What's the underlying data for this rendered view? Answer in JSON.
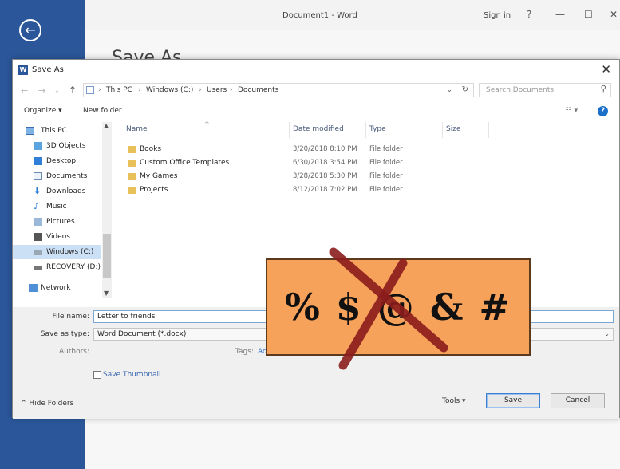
{
  "word": {
    "window_title": "Document1 - Word",
    "sign_in": "Sign in",
    "help": "?",
    "minimize": "—",
    "maximize": "☐",
    "close": "✕",
    "back_arrow": "←",
    "heading": "Save As"
  },
  "dialog": {
    "title": "Save As",
    "close": "✕",
    "back": "←",
    "forward": "→",
    "up": "↑",
    "breadcrumb": [
      "This PC",
      "Windows (C:)",
      "Users",
      "Documents"
    ],
    "search_placeholder": "Search Documents",
    "toolbar": {
      "organize": "Organize ▾",
      "new_folder": "New folder"
    },
    "nav_items": [
      {
        "label": "This PC",
        "icon": "computer-icon"
      },
      {
        "label": "3D Objects",
        "icon": "cube-icon"
      },
      {
        "label": "Desktop",
        "icon": "desktop-icon"
      },
      {
        "label": "Documents",
        "icon": "documents-icon"
      },
      {
        "label": "Downloads",
        "icon": "download-icon"
      },
      {
        "label": "Music",
        "icon": "music-icon"
      },
      {
        "label": "Pictures",
        "icon": "pictures-icon"
      },
      {
        "label": "Videos",
        "icon": "videos-icon"
      },
      {
        "label": "Windows (C:)",
        "icon": "drive-icon",
        "selected": true
      },
      {
        "label": "RECOVERY (D:)",
        "icon": "drive-icon"
      },
      {
        "label": "Network",
        "icon": "network-icon"
      }
    ],
    "columns": [
      "Name",
      "Date modified",
      "Type",
      "Size"
    ],
    "files": [
      {
        "name": "Books",
        "date": "3/20/2018 8:10 PM",
        "type": "File folder"
      },
      {
        "name": "Custom Office Templates",
        "date": "6/30/2018 3:54 PM",
        "type": "File folder"
      },
      {
        "name": "My Games",
        "date": "3/28/2018 5:30 PM",
        "type": "File folder"
      },
      {
        "name": "Projects",
        "date": "8/12/2018 7:02 PM",
        "type": "File folder"
      }
    ],
    "file_name_label": "File name:",
    "file_name_value": "Letter to friends",
    "save_type_label": "Save as type:",
    "save_type_value": "Word Document (*.docx)",
    "authors_label": "Authors:",
    "tags_label": "Tags:",
    "tags_value": "Ad",
    "save_thumbnail": "Save Thumbnail",
    "hide_folders": "Hide Folders",
    "tools": "Tools ▾",
    "save": "Save",
    "cancel": "Cancel"
  },
  "overlay": {
    "symbols": "% $ @ & #",
    "background": "#f7a25a",
    "cross_color": "#8b1d1d"
  }
}
